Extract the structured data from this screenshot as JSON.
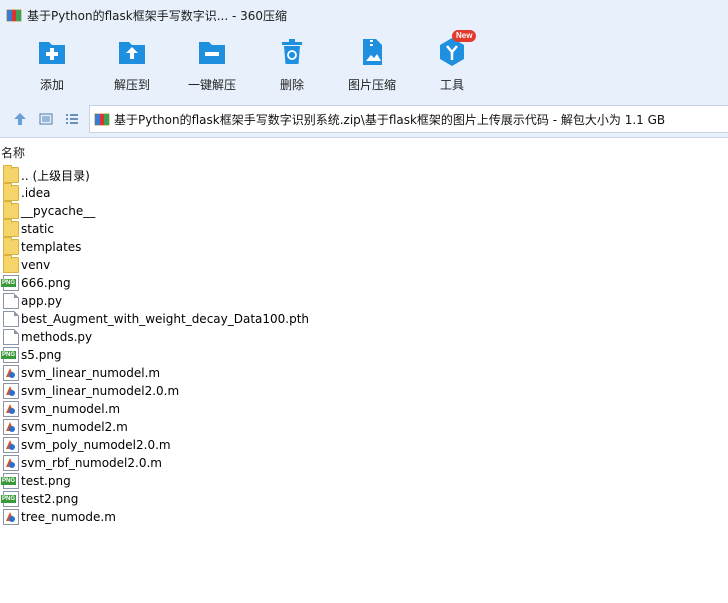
{
  "window": {
    "title": "基于Python的flask框架手写数字识... - 360压缩"
  },
  "toolbar": {
    "items": [
      {
        "label": "添加",
        "icon": "add-icon"
      },
      {
        "label": "解压到",
        "icon": "extract-to-icon"
      },
      {
        "label": "一键解压",
        "icon": "one-click-extract-icon"
      },
      {
        "label": "删除",
        "icon": "delete-icon"
      },
      {
        "label": "图片压缩",
        "icon": "image-compress-icon"
      },
      {
        "label": "工具",
        "icon": "tools-icon"
      }
    ],
    "new_badge": "New"
  },
  "navigation": {
    "path": "基于Python的flask框架手写数字识别系统.zip\\基于flask框架的图片上传展示代码 - 解包大小为 1.1 GB"
  },
  "list": {
    "column_header": "名称",
    "files": [
      {
        "name": ".. (上级目录)",
        "type": "folder"
      },
      {
        "name": ".idea",
        "type": "folder"
      },
      {
        "name": "__pycache__",
        "type": "folder"
      },
      {
        "name": "static",
        "type": "folder"
      },
      {
        "name": "templates",
        "type": "folder"
      },
      {
        "name": "venv",
        "type": "folder"
      },
      {
        "name": "666.png",
        "type": "png"
      },
      {
        "name": "app.py",
        "type": "doc"
      },
      {
        "name": "best_Augment_with_weight_decay_Data100.pth",
        "type": "doc"
      },
      {
        "name": "methods.py",
        "type": "doc"
      },
      {
        "name": "s5.png",
        "type": "png"
      },
      {
        "name": "svm_linear_numodel.m",
        "type": "mfile"
      },
      {
        "name": "svm_linear_numodel2.0.m",
        "type": "mfile"
      },
      {
        "name": "svm_numodel.m",
        "type": "mfile"
      },
      {
        "name": "svm_numodel2.m",
        "type": "mfile"
      },
      {
        "name": "svm_poly_numodel2.0.m",
        "type": "mfile"
      },
      {
        "name": "svm_rbf_numodel2.0.m",
        "type": "mfile"
      },
      {
        "name": "test.png",
        "type": "png"
      },
      {
        "name": "test2.png",
        "type": "png"
      },
      {
        "name": "tree_numode.m",
        "type": "mfile"
      }
    ]
  },
  "colors": {
    "toolbar_bg": "#e8f1fb",
    "accent_blue": "#1f8fe0",
    "badge_red": "#e23b2e"
  }
}
